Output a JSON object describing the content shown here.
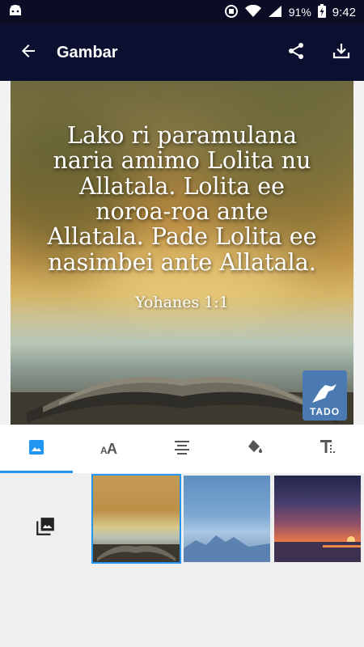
{
  "status_bar": {
    "battery": "91%",
    "time": "9:42"
  },
  "app_bar": {
    "title": "Gambar"
  },
  "quote": {
    "lines": [
      "Lako ri paramulana",
      "naria amimo Lolita nu",
      "Allatala. Lolita ee",
      "noroa-roa ante",
      "Allatala. Pade Lolita ee",
      "nasimbei ante Allatala."
    ],
    "reference": "Yohanes 1:1",
    "logo_text": "TADO"
  },
  "tabs": [
    {
      "icon": "image-icon",
      "active": true
    },
    {
      "icon": "text-size-icon",
      "active": false
    },
    {
      "icon": "align-center-icon",
      "active": false
    },
    {
      "icon": "fill-color-icon",
      "active": false
    },
    {
      "icon": "text-format-icon",
      "active": false
    }
  ],
  "backgrounds": {
    "gallery_icon": "photo-library-icon",
    "selected_index": 0
  },
  "colors": {
    "app_bar": "#0b1030",
    "accent": "#2196f3"
  }
}
